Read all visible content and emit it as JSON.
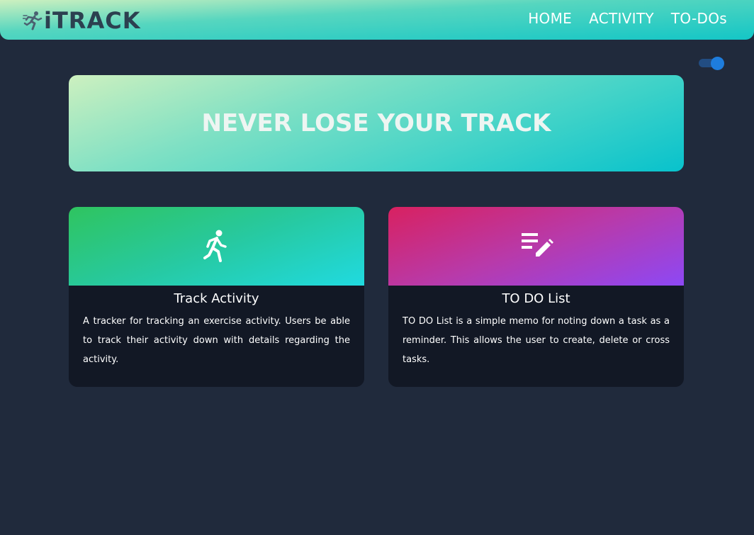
{
  "navbar": {
    "brand_text": "iTRACK",
    "brand_icon": "runner-icon",
    "links": [
      "HOME",
      "ACTIVITY",
      "TO-DOs"
    ]
  },
  "theme_toggle": {
    "state": "on",
    "color": "#1e7ddd"
  },
  "hero": {
    "title": "NEVER LOSE YOUR TRACK"
  },
  "cards": [
    {
      "icon": "walking-person-icon",
      "title": "Track Activity",
      "description": "A tracker for tracking an exercise activity. Users be able to track their activity down with details regarding the activity."
    },
    {
      "icon": "list-edit-icon",
      "title": "TO DO List",
      "description": "TO DO List is a simple memo for noting down a task as a reminder. This allows the user to create, delete or cross tasks."
    }
  ],
  "colors": {
    "background": "#202a3c",
    "card_body": "#121825",
    "brand_text": "#2c4050"
  }
}
